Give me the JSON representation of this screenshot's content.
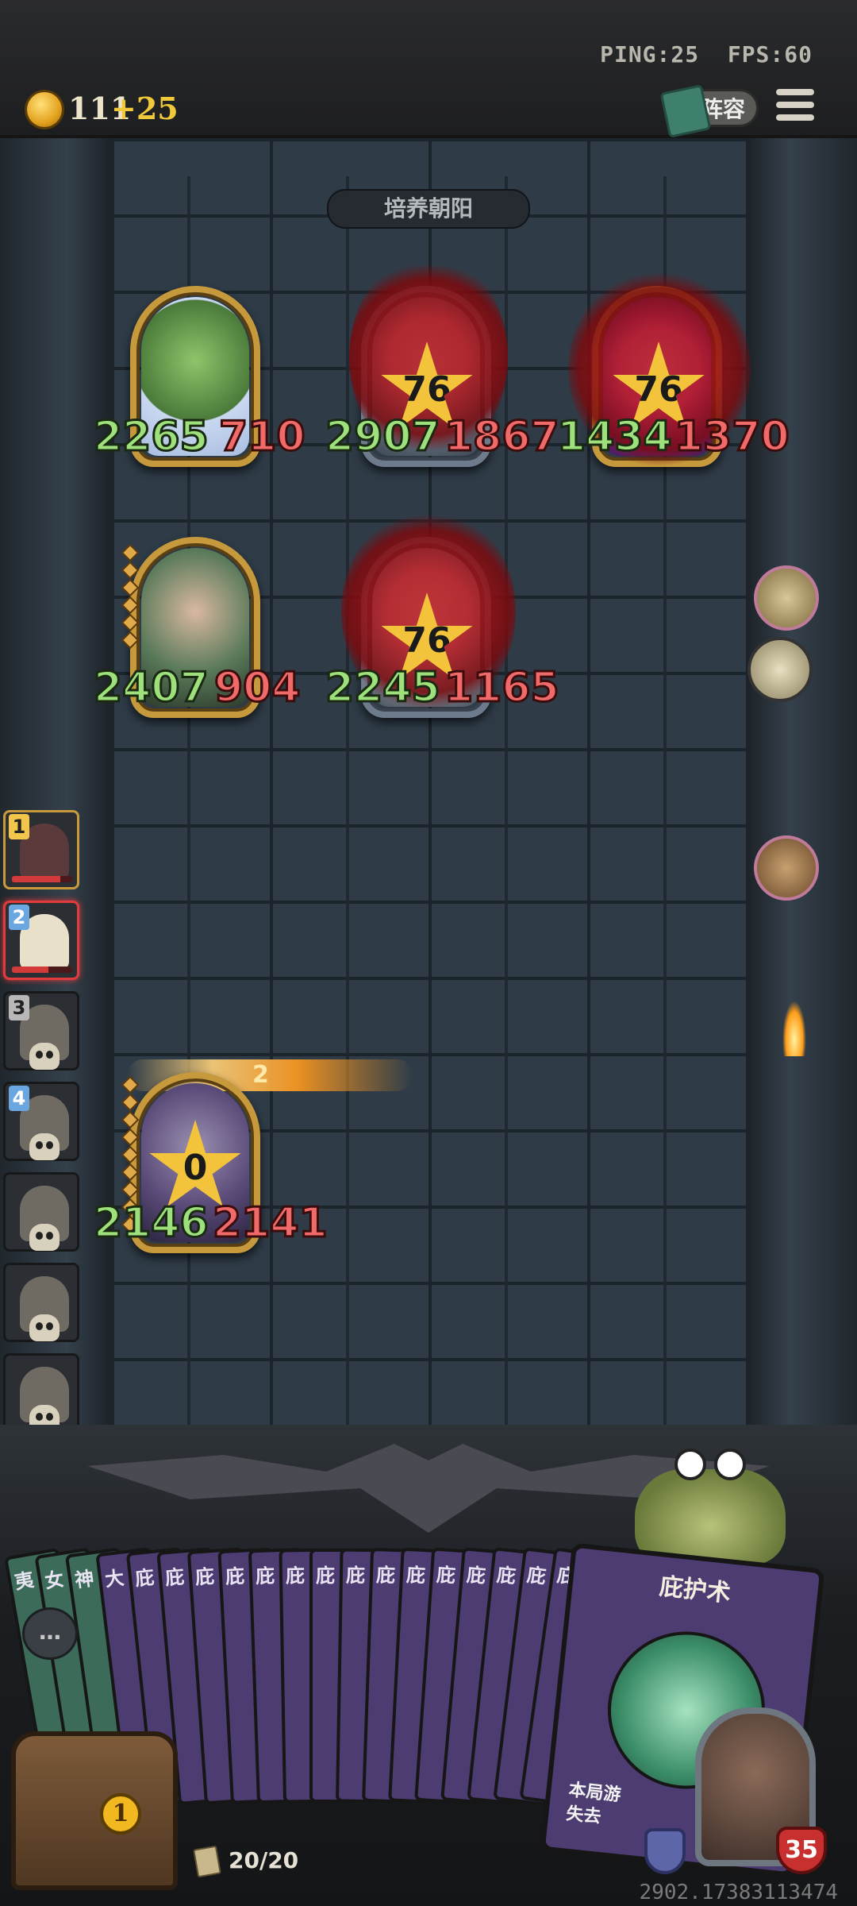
{
  "status": {
    "ping_label": "PING:25",
    "fps_label": "FPS:60"
  },
  "currency": {
    "coins": "111",
    "gain": "+25",
    "icon": "crown-coin-icon"
  },
  "header": {
    "lineup_label": "阵容",
    "menu_icon": "hamburger-menu-icon"
  },
  "board": {
    "title": "培养朝阳",
    "enemy_row1": [
      {
        "name": "tree-unit",
        "attack": "2265",
        "health": "710",
        "level": null
      },
      {
        "name": "horned-beast-unit",
        "attack": "2907",
        "health": "1867",
        "level": "76"
      },
      {
        "name": "crystal-unit",
        "attack": "1434",
        "health": "1370",
        "level": "76"
      }
    ],
    "enemy_row2": [
      {
        "name": "elf-woman-unit",
        "attack": "2407",
        "health": "904",
        "level": null
      },
      {
        "name": "white-hair-unit",
        "attack": "2245",
        "health": "1165",
        "level": "76"
      }
    ],
    "player_unit": {
      "name": "armored-knight-unit",
      "attack": "2146",
      "health": "2141",
      "level": "0",
      "effect_text": "2"
    }
  },
  "turn_queue": [
    {
      "num": "1",
      "style": "gold",
      "hp_pct": 80
    },
    {
      "num": "2",
      "style": "red",
      "hp_pct": 60
    },
    {
      "num": "3",
      "style": "dead"
    },
    {
      "num": "4",
      "style": "dead"
    },
    {
      "num": "",
      "style": "dead"
    },
    {
      "num": "",
      "style": "dead"
    },
    {
      "num": "",
      "style": "dead"
    },
    {
      "num": "",
      "style": "dead"
    }
  ],
  "hand": {
    "card_initials": [
      "夷",
      "女",
      "神",
      "大",
      "庇",
      "庇",
      "庇",
      "庇",
      "庇",
      "庇",
      "庇",
      "庇",
      "庇",
      "庇",
      "庇",
      "庇",
      "庇",
      "庇",
      "庇",
      "庇",
      "庇"
    ],
    "featured_card": {
      "name": "庇护术",
      "desc_line1": "本局游",
      "desc_line2": "失去"
    }
  },
  "chest": {
    "badge": "1"
  },
  "deck": {
    "count": "20/20"
  },
  "hero": {
    "health": "35"
  },
  "chat_icon": "chat-bubble-icon",
  "footer_id": "2902.17383113474",
  "colors": {
    "attack": "#9ee07b",
    "health": "#f06a6a",
    "gold_frame": "#c69a3c",
    "card_purple": "#4d3c72"
  }
}
